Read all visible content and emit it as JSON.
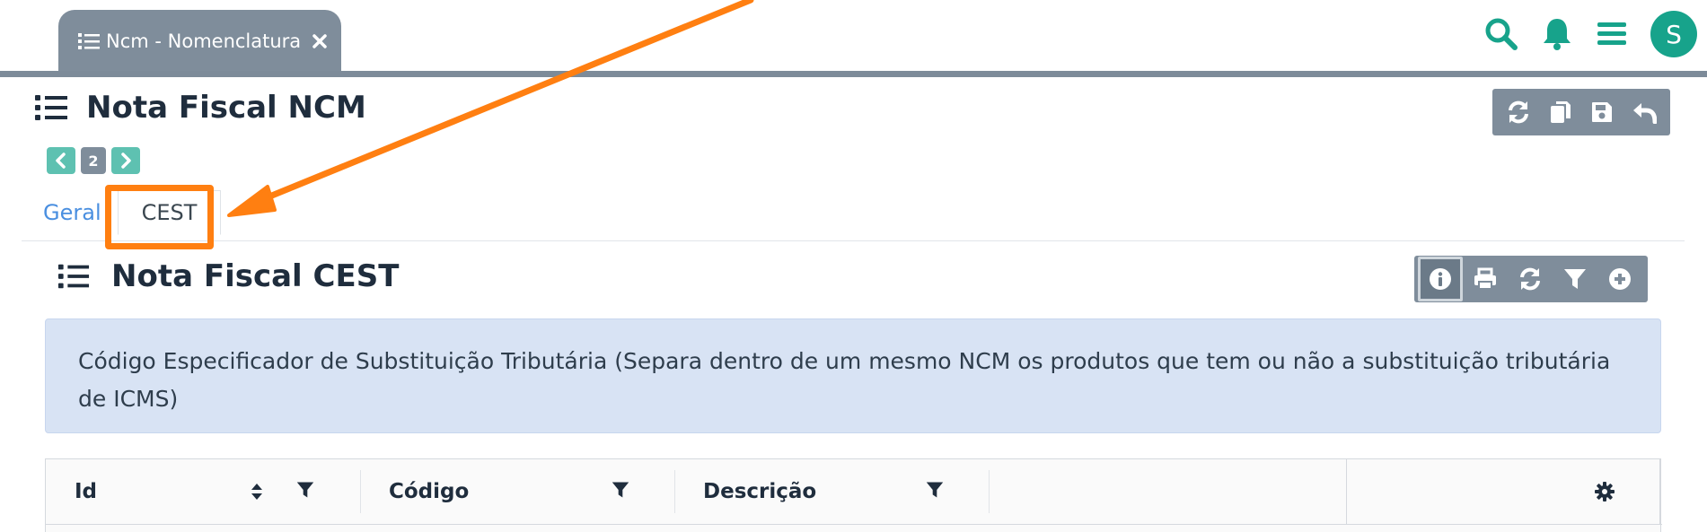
{
  "tabbar": {
    "active_tab_label": "Ncm - Nomenclatura",
    "icons": [
      "list-icon",
      "close-icon"
    ]
  },
  "header_icons": [
    "search-icon",
    "bell-icon",
    "menu-icon"
  ],
  "avatar": {
    "initial": "S",
    "color": "#17a38b"
  },
  "page": {
    "title": "Nota Fiscal NCM",
    "toolbar": [
      "refresh-icon",
      "copy-icon",
      "save-icon",
      "undo-icon"
    ]
  },
  "pager": {
    "current": "2"
  },
  "tabs": [
    {
      "label": "Geral",
      "active": false
    },
    {
      "label": "CEST",
      "active": true
    }
  ],
  "section": {
    "title": "Nota Fiscal CEST",
    "toolbar": [
      "info-icon",
      "print-icon",
      "refresh-icon",
      "filter-icon",
      "add-icon"
    ],
    "info_text": "Código Especificador de Substituição Tributária (Separa dentro de um mesmo NCM os produtos que tem ou não a substituição tributária de ICMS)"
  },
  "table": {
    "columns": [
      {
        "label": "Id",
        "sortable": true,
        "filterable": true
      },
      {
        "label": "Código",
        "sortable": false,
        "filterable": true
      },
      {
        "label": "Descrição",
        "sortable": false,
        "filterable": true
      }
    ],
    "settings_icon": "gear-icon"
  },
  "colors": {
    "accent": "#17a38b",
    "toolbar_bg": "#7f8d9b",
    "info_bg": "#d8e3f4",
    "annotation": "#ff7f11",
    "link": "#4a8fe0"
  }
}
